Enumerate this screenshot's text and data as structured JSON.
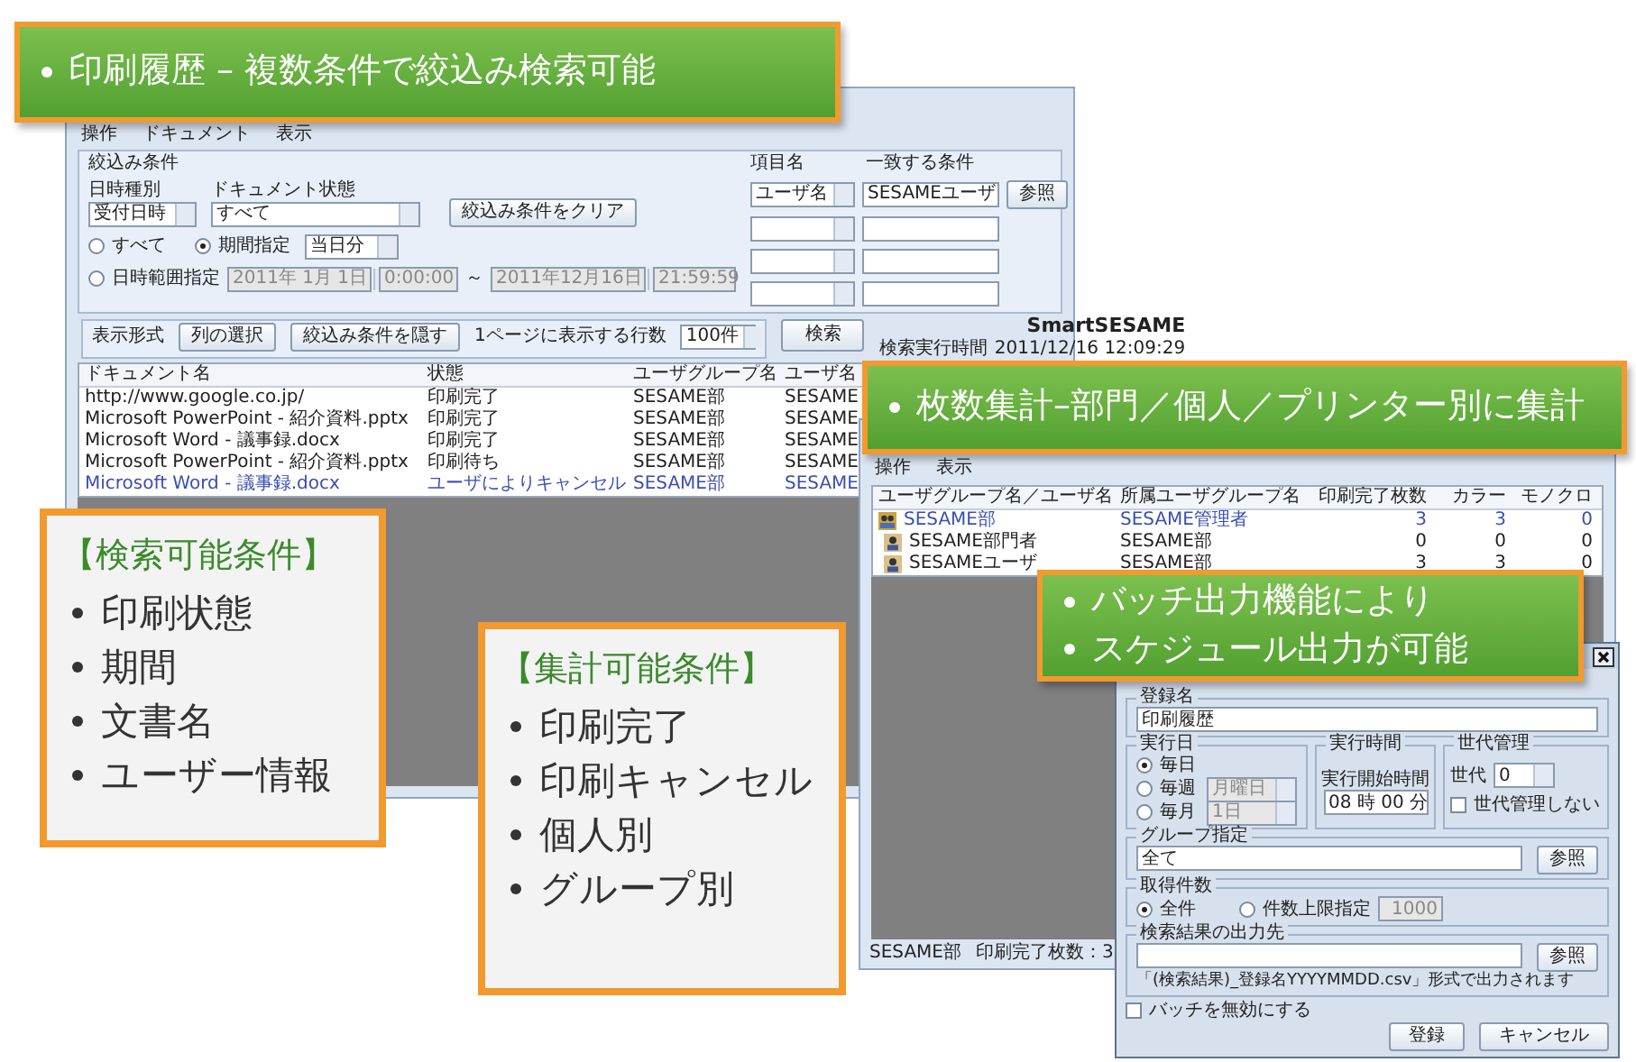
{
  "history_window": {
    "menu": [
      "操作",
      "ドキュメント",
      "表示"
    ],
    "filter": {
      "title": "絞込み条件",
      "date_type": {
        "label": "日時種別",
        "value": "受付日時"
      },
      "doc_state": {
        "label": "ドキュメント状態",
        "value": "すべて"
      },
      "clear_button": "絞込み条件をクリア",
      "period_options": [
        {
          "label": "すべて",
          "selected": false
        },
        {
          "label": "期間指定",
          "selected": true
        },
        {
          "label": "日時範囲指定",
          "selected": false
        }
      ],
      "period_value": "当日分",
      "range": {
        "from_date": "2011年 1月 1日",
        "from_time": "0:00:00",
        "separator": "～",
        "to_date": "2011年12月16日",
        "to_time": "21:59:59"
      },
      "item_label": "項目名",
      "match_label": "一致する条件",
      "conditions": [
        {
          "kind": "filled",
          "item": "ユーザ名",
          "value": "SESAMEユーザ"
        },
        {
          "kind": "empty"
        },
        {
          "kind": "empty"
        },
        {
          "kind": "empty"
        }
      ],
      "browse_button": "参照"
    },
    "display": {
      "title": "表示形式",
      "buttons": [
        "列の選択",
        "絞込み条件を隠す"
      ],
      "rows_label": "1ページに表示する行数",
      "rows_value": "100件",
      "search_button": "検索",
      "brand": "SmartSESAME",
      "time_label": "検索実行時間",
      "time_value": "2011/12/16 12:09:29"
    },
    "table": {
      "columns": [
        "ドキュメント名",
        "状態",
        "ユーザグループ名",
        "ユーザ名"
      ],
      "rows": [
        {
          "cells": [
            "http://www.google.co.jp/",
            "印刷完了",
            "SESAME部",
            "SESAME"
          ],
          "cancelled": false
        },
        {
          "cells": [
            "Microsoft PowerPoint - 紹介資料.pptx",
            "印刷完了",
            "SESAME部",
            "SESAME"
          ],
          "cancelled": false
        },
        {
          "cells": [
            "Microsoft Word - 議事録.docx",
            "印刷完了",
            "SESAME部",
            "SESAME"
          ],
          "cancelled": false
        },
        {
          "cells": [
            "Microsoft PowerPoint - 紹介資料.pptx",
            "印刷待ち",
            "SESAME部",
            "SESAME"
          ],
          "cancelled": false
        },
        {
          "cells": [
            "Microsoft Word - 議事録.docx",
            "ユーザによりキャンセル",
            "SESAME部",
            "SESAME"
          ],
          "cancelled": true
        }
      ]
    }
  },
  "tally_window": {
    "menu": [
      "操作",
      "表示"
    ],
    "columns": [
      "ユーザグループ名／ユーザ名",
      "所属ユーザグループ名",
      "印刷完了枚数",
      "カラー",
      "モノクロ"
    ],
    "rows": [
      {
        "kind": "group",
        "cells": [
          "SESAME部",
          "SESAME管理者",
          "3",
          "3",
          "0"
        ]
      },
      {
        "kind": "user",
        "cells": [
          "SESAME部門者",
          "SESAME部",
          "0",
          "0",
          "0"
        ]
      },
      {
        "kind": "user",
        "cells": [
          "SESAMEユーザ",
          "SESAME部",
          "3",
          "3",
          "0"
        ]
      }
    ],
    "status": [
      "SESAME部",
      "印刷完了枚数：3"
    ]
  },
  "batch_dialog": {
    "name_group": {
      "legend": "登録名",
      "value": "印刷履歴"
    },
    "run_day": {
      "legend": "実行日",
      "options": [
        {
          "label": "毎日",
          "selected": true
        },
        {
          "label": "毎週",
          "selected": false,
          "select": "月曜日"
        },
        {
          "label": "毎月",
          "selected": false,
          "select": "1日"
        }
      ]
    },
    "run_time": {
      "legend": "実行時間",
      "label": "実行開始時間",
      "value": "08 時 00 分"
    },
    "generations": {
      "legend": "世代管理",
      "label": "世代",
      "value": "0",
      "checkbox": {
        "label": "世代管理しない",
        "checked": false
      }
    },
    "group": {
      "legend": "グループ指定",
      "value": "全て",
      "button": "参照"
    },
    "count": {
      "legend": "取得件数",
      "options": [
        {
          "label": "全件",
          "selected": true
        },
        {
          "label": "件数上限指定",
          "selected": false,
          "value": "1000"
        }
      ]
    },
    "output": {
      "legend": "検索結果の出力先",
      "button": "参照",
      "note": "「(検索結果)_登録名YYYYMMDD.csv」形式で出力されます"
    },
    "disable_checkbox": {
      "label": "バッチを無効にする",
      "checked": false
    },
    "buttons": [
      "登録",
      "キャンセル"
    ]
  },
  "callouts": [
    {
      "kind": "banner",
      "items": [
        "印刷履歴 – 複数条件で絞込み検索可能"
      ]
    },
    {
      "kind": "box",
      "title": "【検索可能条件】",
      "items": [
        "印刷状態",
        "期間",
        "文書名",
        "ユーザー情報"
      ]
    },
    {
      "kind": "banner",
      "items": [
        "枚数集計–部門／個人／プリンター別に集計"
      ]
    },
    {
      "kind": "box",
      "title": "【集計可能条件】",
      "items": [
        "印刷完了",
        "印刷キャンセル",
        "個人別",
        "グループ別"
      ]
    },
    {
      "kind": "banner",
      "items": [
        "バッチ出力機能により",
        "スケジュール出力が可能"
      ]
    }
  ]
}
